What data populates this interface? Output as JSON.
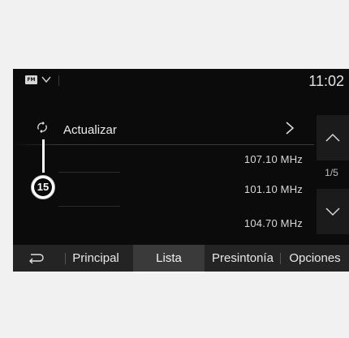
{
  "statusbar": {
    "source_badge": "FM",
    "clock": "11:02"
  },
  "list": {
    "update_label": "Actualizar",
    "stations": [
      {
        "frequency": "107.10 MHz"
      },
      {
        "frequency": "101.10 MHz"
      },
      {
        "frequency": "104.70 MHz"
      }
    ]
  },
  "scroll": {
    "page_indicator": "1/5"
  },
  "callout": {
    "number": "15"
  },
  "tabs": [
    {
      "label": "Principal",
      "active": false
    },
    {
      "label": "Lista",
      "active": true
    },
    {
      "label": "Presintonía",
      "active": false
    },
    {
      "label": "Opciones",
      "active": false
    }
  ],
  "icons": {
    "source": "fm-source-icon",
    "source_dropdown": "chevron-down-icon",
    "refresh": "refresh-icon",
    "open": "chevron-right-icon",
    "scroll_up": "chevron-up-icon",
    "scroll_down": "chevron-down-icon",
    "back": "back-arrow-icon"
  },
  "colors": {
    "screen_bg": "#0b0b0b",
    "page_bg": "#f1f1f1",
    "tabbar_bg": "#242424",
    "active_tab_bg": "#3a3a3a",
    "scroll_button_bg": "#1b1b1b",
    "text": "#eaeaea"
  }
}
